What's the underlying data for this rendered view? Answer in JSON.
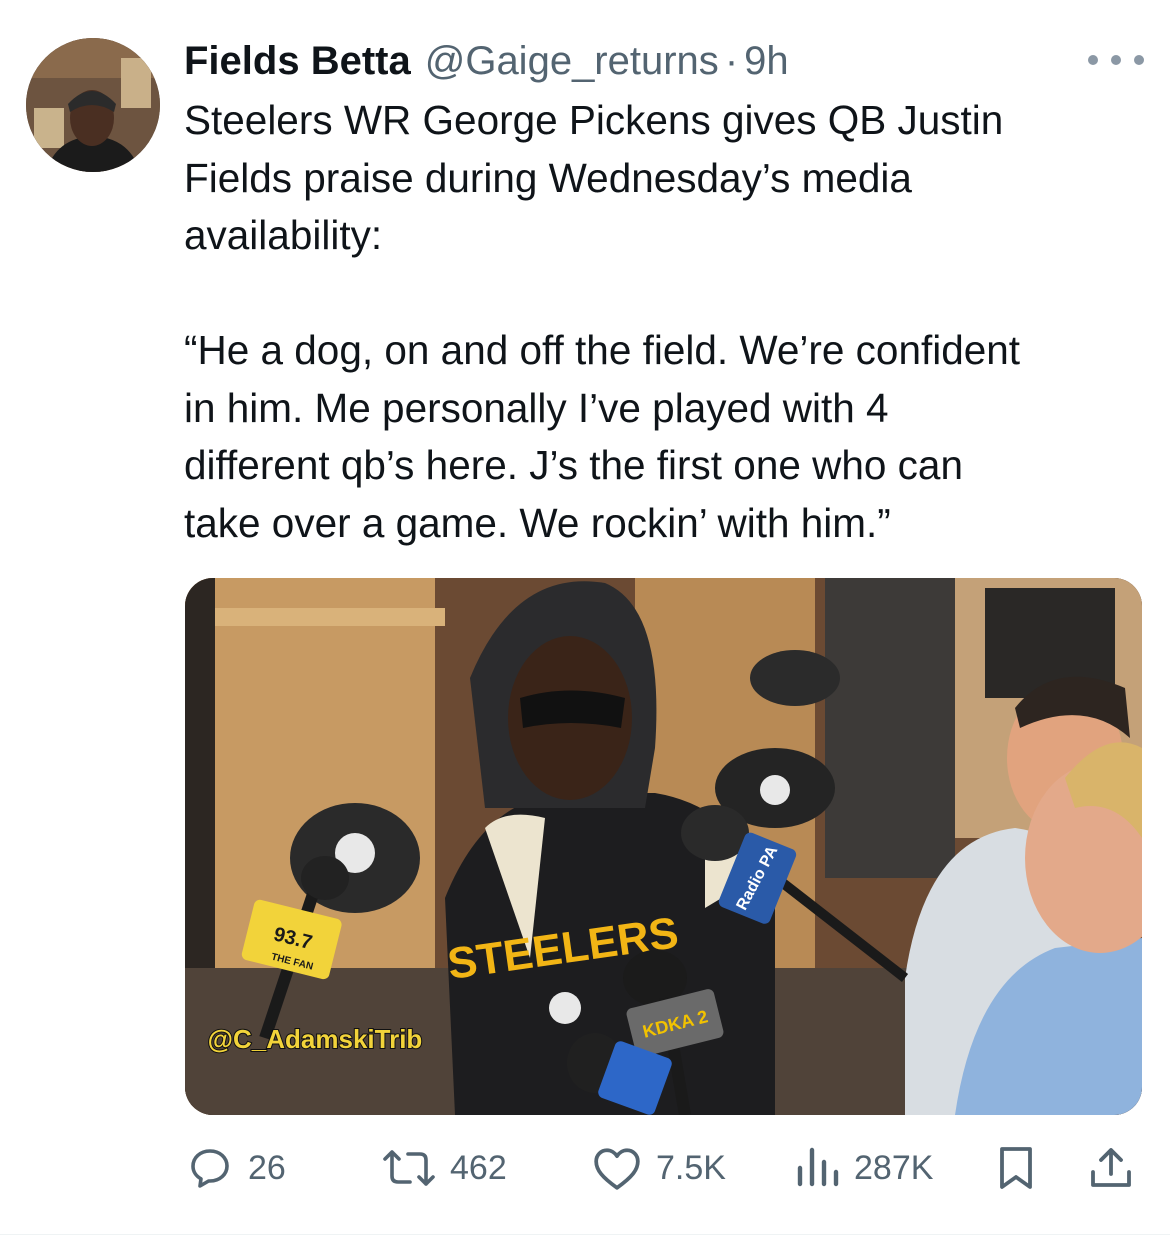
{
  "tweet": {
    "author_name": "Fields Betta",
    "handle": "@Gaige_returns",
    "separator": "·",
    "time": "9h",
    "text": "Steelers WR George Pickens gives QB Justin\nFields praise during Wednesday’s media\navailability:\n\n“He a dog, on and off the field. We’re confident\nin him. Me personally I’ve played with 4\ndifferent qb’s here. J’s the first one who can\ntake over a game. We rockin’ with him.”"
  },
  "media": {
    "watermark": "@C_AdamskiTrib",
    "mic_label_1": "93.7",
    "mic_label_1_sub": "THE FAN",
    "mic_label_2": "Radio PA",
    "mic_label_3": "KDKA 2",
    "shirt_text": "STEELERS"
  },
  "actions": {
    "replies": "26",
    "reposts": "462",
    "likes": "7.5K",
    "views": "287K"
  },
  "icons": {
    "reply": "reply-icon",
    "repost": "repost-icon",
    "like": "heart-icon",
    "views": "views-icon",
    "bookmark": "bookmark-icon",
    "share": "share-icon",
    "more": "more-icon"
  },
  "colors": {
    "text": "#0f1419",
    "secondary": "#536471"
  }
}
